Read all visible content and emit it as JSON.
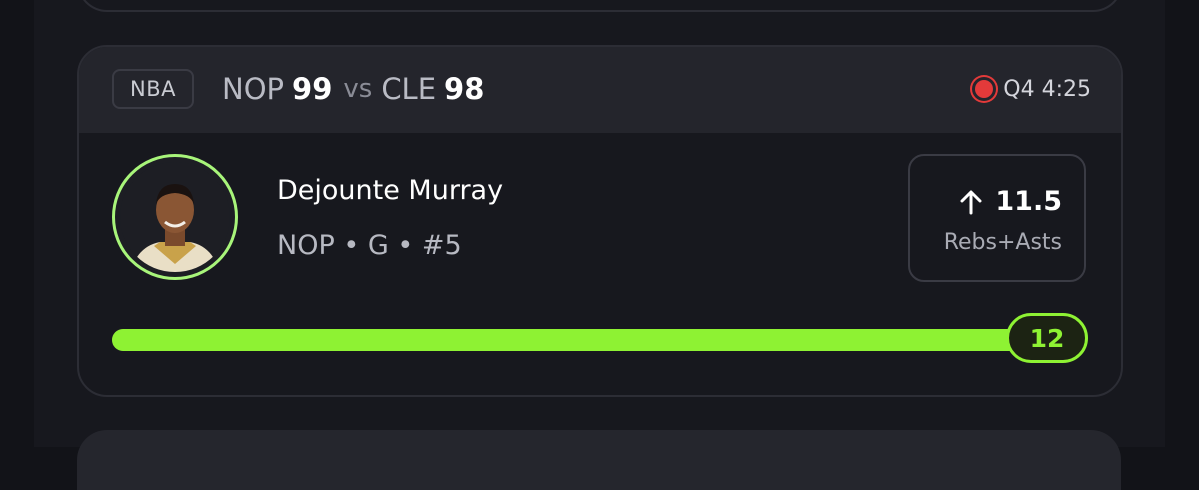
{
  "game": {
    "league": "NBA",
    "home_team": "NOP",
    "home_score": "99",
    "vs_label": "vs",
    "away_team": "CLE",
    "away_score": "98",
    "status": "Q4 4:25",
    "live_color": "#e33a3a"
  },
  "player": {
    "name": "Dejounte Murray",
    "meta": "NOP • G • #5",
    "avatar_icon": "player-headshot",
    "ring_color": "#a8f57a"
  },
  "prop": {
    "direction_icon": "arrow-up-icon",
    "line": "11.5",
    "stat": "Rebs+Asts"
  },
  "progress": {
    "current": "12",
    "fraction": 0.96,
    "fill_color": "#8ef233"
  }
}
